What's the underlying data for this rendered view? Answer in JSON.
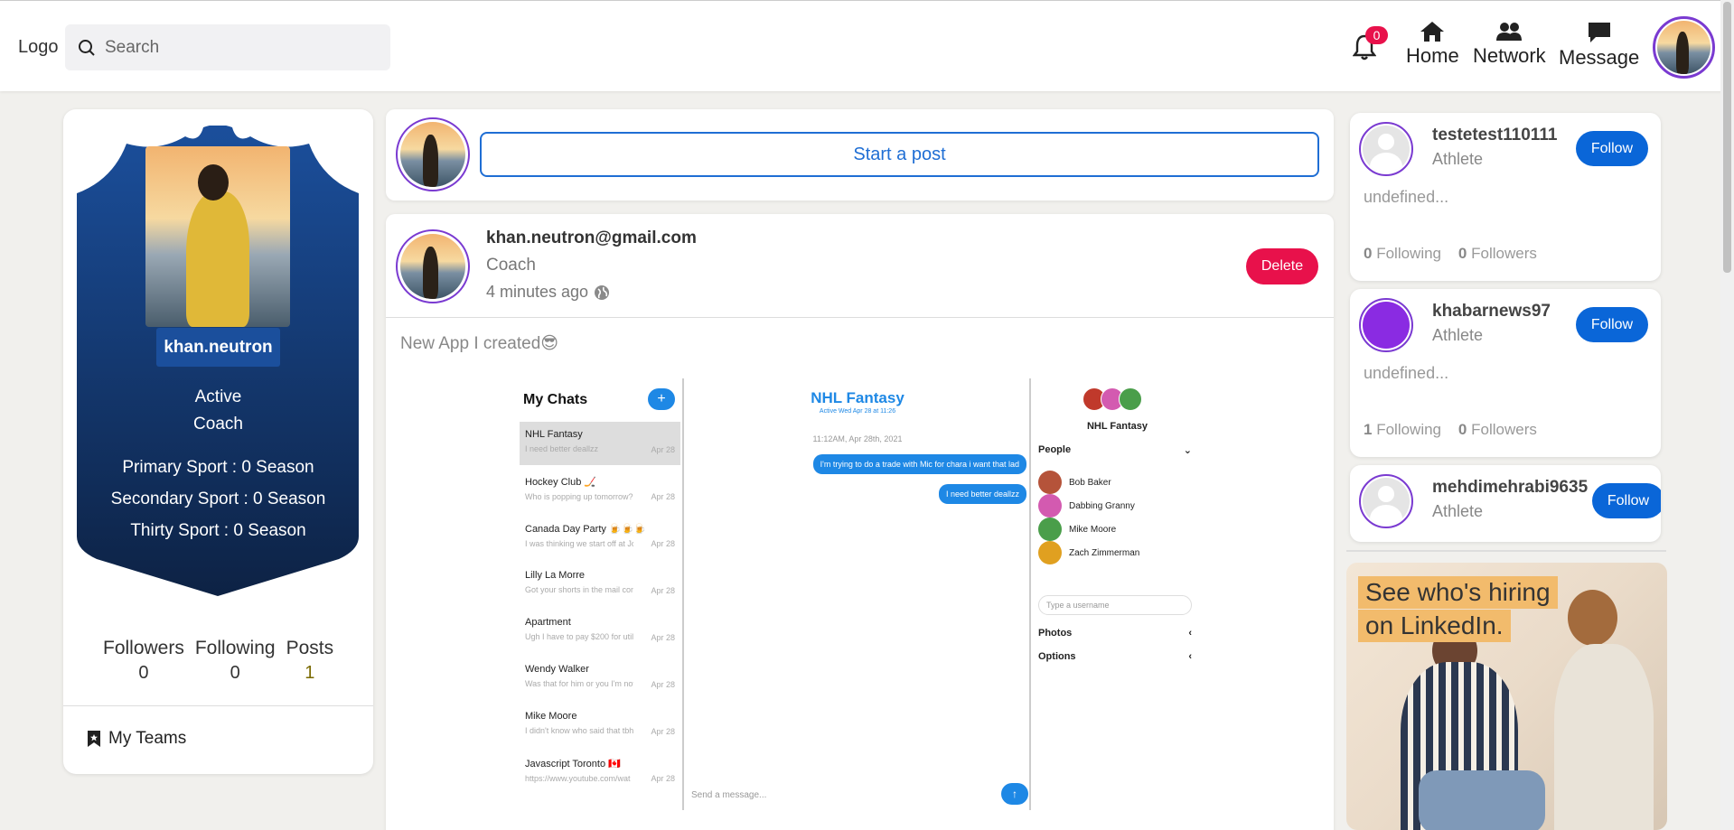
{
  "header": {
    "logo": "Logo",
    "search_placeholder": "Search",
    "notifications_count": "0",
    "nav": [
      {
        "label": "Home",
        "icon": "home-icon"
      },
      {
        "label": "Network",
        "icon": "people-icon"
      },
      {
        "label": "Message",
        "icon": "message-icon"
      }
    ]
  },
  "profile": {
    "username": "khan.neutron",
    "status": "Active",
    "role": "Coach",
    "sports": [
      "Primary Sport : 0 Season",
      "Secondary Sport : 0 Season",
      "Thirty Sport : 0 Season"
    ],
    "stats": [
      {
        "label": "Followers",
        "value": "0"
      },
      {
        "label": "Following",
        "value": "0"
      },
      {
        "label": "Posts",
        "value": "1"
      }
    ],
    "my_teams": "My Teams"
  },
  "composer": {
    "start_post": "Start a post"
  },
  "post": {
    "author_email": "khan.neutron@gmail.com",
    "author_role": "Coach",
    "time": "4 minutes ago",
    "delete_label": "Delete",
    "text": "New App I created😎",
    "screenshot": {
      "chats_title": "My Chats",
      "plus": "+",
      "chats": [
        {
          "name": "NHL Fantasy",
          "preview": "I need better deallzz",
          "date": "Apr 28"
        },
        {
          "name": "Hockey Club 🏒",
          "preview": "Who is popping up tomorrow?",
          "date": "Apr 28"
        },
        {
          "name": "Canada Day Party 🍺🍺🍺",
          "preview": "I was thinking we start off at Jo",
          "date": "Apr 28"
        },
        {
          "name": "Lilly La Morre",
          "preview": "Got your shorts in the mail con",
          "date": "Apr 28"
        },
        {
          "name": "Apartment",
          "preview": "Ugh I have to pay $200 for utili",
          "date": "Apr 28"
        },
        {
          "name": "Wendy Walker",
          "preview": "Was that for him or you I'm not",
          "date": "Apr 28"
        },
        {
          "name": "Mike Moore",
          "preview": "I didn't know who said that tbh",
          "date": "Apr 28"
        },
        {
          "name": "Javascript Toronto 🇨🇦",
          "preview": "https://www.youtube.com/wat",
          "date": "Apr 28"
        }
      ],
      "conv_title": "NHL Fantasy",
      "conv_sub": "Active Wed Apr 28 at 11:26",
      "conv_date": "11:12AM, Apr 28th, 2021",
      "messages": [
        "I'm trying to do a trade with Mic for chara i want that lad",
        "I need better deallzz"
      ],
      "send_placeholder": "Send a message...",
      "send_btn": "↑",
      "group_name": "NHL Fantasy",
      "people_label": "People",
      "people": [
        "Bob Baker",
        "Dabbing Granny",
        "Mike Moore",
        "Zach Zimmerman"
      ],
      "username_placeholder": "Type a username",
      "photos_label": "Photos",
      "options_label": "Options"
    }
  },
  "suggestions": [
    {
      "name": "testetest110111",
      "role": "Athlete",
      "bio": "undefined...",
      "following": "0",
      "followers": "0",
      "follow_label": "Follow",
      "avatar": "blank"
    },
    {
      "name": "khabarnews97",
      "role": "Athlete",
      "bio": "undefined...",
      "following": "1",
      "followers": "0",
      "follow_label": "Follow",
      "avatar": "purple"
    },
    {
      "name": "mehdimehrabi9635",
      "role": "Athlete",
      "follow_label": "Follow",
      "avatar": "blank"
    }
  ],
  "suggestion_labels": {
    "following": "Following",
    "followers": "Followers"
  },
  "ad": {
    "line1": "See who's hiring",
    "line2": "on LinkedIn."
  },
  "colors": {
    "accent_blue": "#1f6ed4",
    "delete_red": "#e8114b",
    "avatar_ring": "#7a3ad1",
    "shield_top": "#1b4f9c",
    "shield_bottom": "#0d2244"
  }
}
